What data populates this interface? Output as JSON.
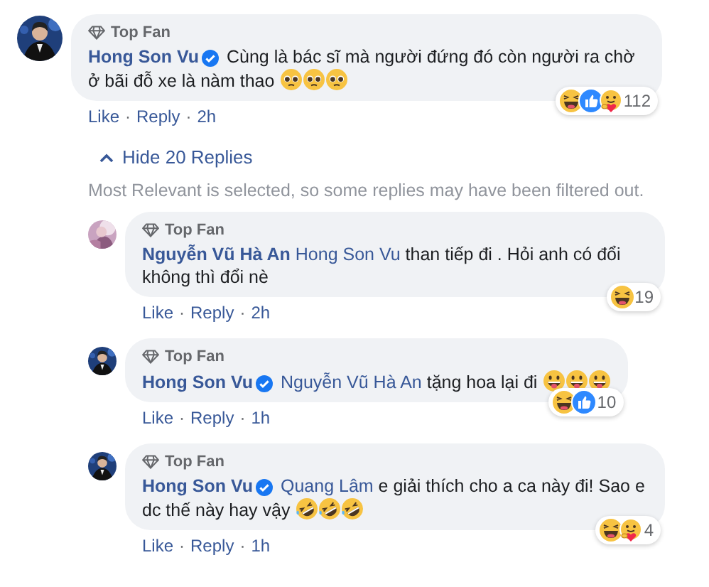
{
  "comment": {
    "avatar": {
      "kind": "picture"
    },
    "badge": "Top Fan",
    "author": "Hong Son Vu",
    "verified": true,
    "text": "Cùng là bác sĩ mà người đứng đó còn người ra chờ ở bãi đỗ xe là nàm thao",
    "emojis": [
      {
        "kind": "pleading"
      },
      {
        "kind": "pleading"
      },
      {
        "kind": "pleading"
      }
    ],
    "reactions": [
      {
        "kind": "haha"
      },
      {
        "kind": "like"
      },
      {
        "kind": "care"
      }
    ],
    "reaction_count": "112",
    "actions": [
      {
        "kind": "link",
        "label": "Like"
      },
      {
        "kind": "separator",
        "label": "·"
      },
      {
        "kind": "link",
        "label": "Reply"
      },
      {
        "kind": "separator",
        "label": "·"
      },
      {
        "kind": "time",
        "label": "2h"
      }
    ]
  },
  "replies_toggle": {
    "label": "Hide 20 Replies",
    "expanded": true
  },
  "filter_note": "Most Relevant is selected, so some replies may have been filtered out.",
  "replies": [
    {
      "avatar": {
        "kind": "picture"
      },
      "badge": "Top Fan",
      "author": "Nguyễn Vũ Hà An",
      "verified": false,
      "mention": "Hong Son Vu",
      "text": "than tiếp đi . Hỏi anh có đổi không thì đổi nè",
      "reactions": [
        {
          "kind": "haha"
        }
      ],
      "reaction_count": "19",
      "actions": [
        {
          "kind": "link",
          "label": "Like"
        },
        {
          "kind": "separator",
          "label": "·"
        },
        {
          "kind": "link",
          "label": "Reply"
        },
        {
          "kind": "separator",
          "label": "·"
        },
        {
          "kind": "time",
          "label": "2h"
        }
      ]
    },
    {
      "avatar": {
        "kind": "picture"
      },
      "badge": "Top Fan",
      "author": "Hong Son Vu",
      "verified": true,
      "mention": "Nguyễn Vũ Hà An",
      "text": "tặng hoa lại đi",
      "emojis": [
        {
          "kind": "tongue"
        },
        {
          "kind": "tongue"
        },
        {
          "kind": "tongue"
        }
      ],
      "reactions": [
        {
          "kind": "haha"
        },
        {
          "kind": "like"
        }
      ],
      "reaction_count": "10",
      "actions": [
        {
          "kind": "link",
          "label": "Like"
        },
        {
          "kind": "separator",
          "label": "·"
        },
        {
          "kind": "link",
          "label": "Reply"
        },
        {
          "kind": "separator",
          "label": "·"
        },
        {
          "kind": "time",
          "label": "1h"
        }
      ]
    },
    {
      "avatar": {
        "kind": "picture"
      },
      "badge": "Top Fan",
      "author": "Hong Son Vu",
      "verified": true,
      "mention": "Quang Lâm",
      "text": "e giải thích cho a ca này đi! Sao e dc thế này hay vậy",
      "emojis": [
        {
          "kind": "rofl"
        },
        {
          "kind": "rofl"
        },
        {
          "kind": "rofl"
        }
      ],
      "reactions": [
        {
          "kind": "haha"
        },
        {
          "kind": "care"
        }
      ],
      "reaction_count": "4",
      "actions": [
        {
          "kind": "link",
          "label": "Like"
        },
        {
          "kind": "separator",
          "label": "·"
        },
        {
          "kind": "link",
          "label": "Reply"
        },
        {
          "kind": "separator",
          "label": "·"
        },
        {
          "kind": "time",
          "label": "1h"
        }
      ]
    }
  ]
}
